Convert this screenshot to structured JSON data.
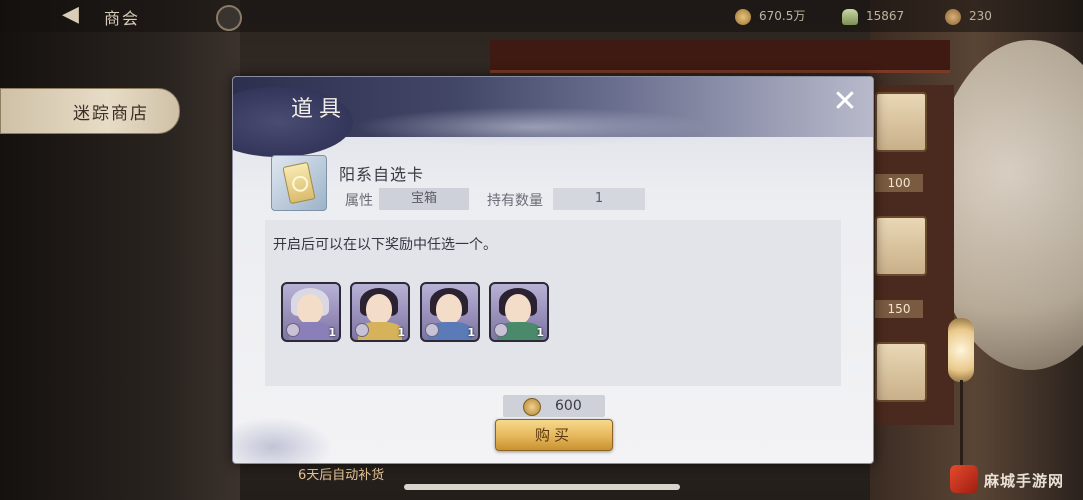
{
  "topbar": {
    "title": "商会",
    "resources": [
      {
        "icon": "copper-coin-icon",
        "value": "670.5万"
      },
      {
        "icon": "ingot-icon",
        "value": "15867"
      },
      {
        "icon": "jade-coin-icon",
        "value": "230"
      }
    ]
  },
  "sidebar": {
    "active_tab": "迷踪商店"
  },
  "background": {
    "shop_prices": [
      "100",
      "150"
    ],
    "restock_text": "6天后自动补货"
  },
  "dialog": {
    "title": "道具",
    "item": {
      "name": "阳系自选卡",
      "attr_label": "属性",
      "attr_value": "宝箱",
      "owned_label": "持有数量",
      "owned_value": "1"
    },
    "description": "开启后可以在以下奖励中任选一个。",
    "rewards": [
      {
        "icon": "hero-portrait-white-hair-icon",
        "count": "1"
      },
      {
        "icon": "hero-portrait-noble-woman-icon",
        "count": "1"
      },
      {
        "icon": "hero-portrait-young-woman-icon",
        "count": "1"
      },
      {
        "icon": "hero-portrait-swordsman-icon",
        "count": "1"
      }
    ],
    "price": "600",
    "buy_label": "购买"
  },
  "watermark": "麻城手游网"
}
